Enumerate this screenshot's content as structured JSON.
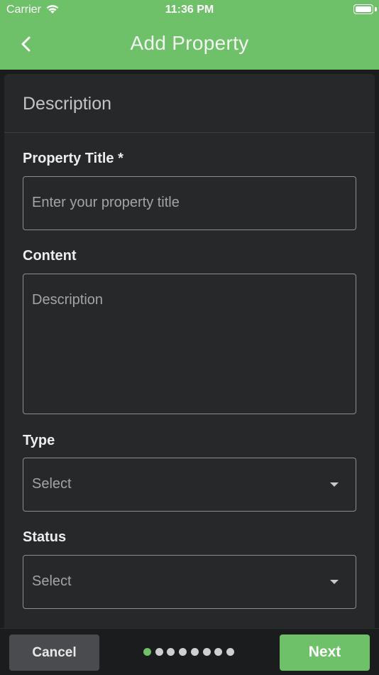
{
  "status_bar": {
    "carrier": "Carrier",
    "time": "11:36 PM"
  },
  "header": {
    "title": "Add Property",
    "back_icon": "chevron-left-icon",
    "background": "#6ec069"
  },
  "form": {
    "section_title": "Description",
    "property_title": {
      "label": "Property Title *",
      "placeholder": "Enter your property title"
    },
    "content": {
      "label": "Content",
      "placeholder": "Description"
    },
    "type": {
      "label": "Type",
      "value": "Select"
    },
    "status": {
      "label": "Status",
      "value": "Select"
    }
  },
  "footer": {
    "cancel_label": "Cancel",
    "next_label": "Next",
    "step_count": 8,
    "current_step": 1,
    "active_dot_color": "#6ec069"
  }
}
